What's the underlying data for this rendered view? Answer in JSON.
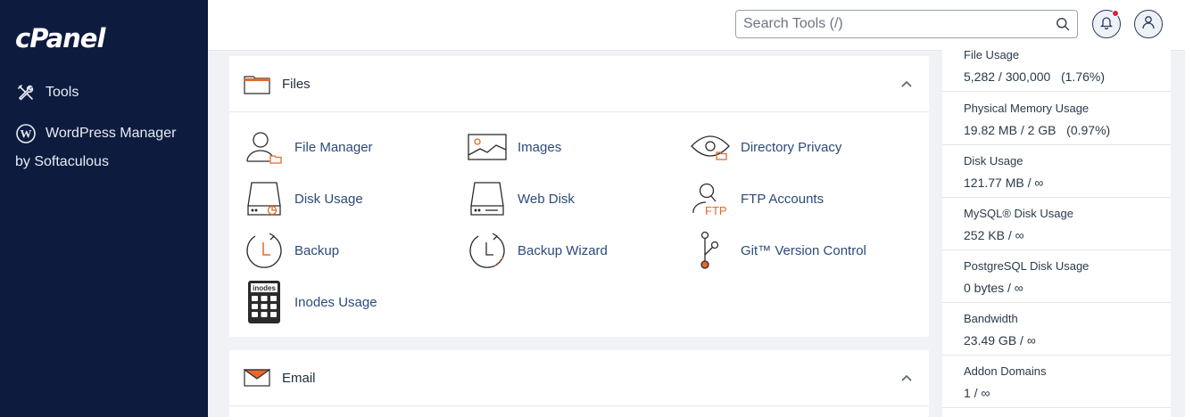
{
  "brand": {
    "logo_text": "cPanel"
  },
  "sidebar": {
    "items": [
      {
        "label": "Tools",
        "icon": "tools-icon"
      },
      {
        "label": "WordPress Manager",
        "sub": "by Softaculous",
        "icon": "wordpress-icon"
      }
    ]
  },
  "topbar": {
    "search_placeholder": "Search Tools (/)",
    "notification_badge_color": "#d6263a"
  },
  "panels": [
    {
      "title": "Files",
      "tools": [
        {
          "label": "File Manager",
          "icon": "file-manager-icon"
        },
        {
          "label": "Images",
          "icon": "images-icon"
        },
        {
          "label": "Directory Privacy",
          "icon": "directory-privacy-icon"
        },
        {
          "label": "Disk Usage",
          "icon": "disk-usage-icon"
        },
        {
          "label": "Web Disk",
          "icon": "web-disk-icon"
        },
        {
          "label": "FTP Accounts",
          "icon": "ftp-accounts-icon"
        },
        {
          "label": "Backup",
          "icon": "backup-icon"
        },
        {
          "label": "Backup Wizard",
          "icon": "backup-wizard-icon"
        },
        {
          "label": "Git™ Version Control",
          "icon": "git-icon"
        },
        {
          "label": "Inodes Usage",
          "icon": "inodes-icon",
          "icon_text": "inodes"
        }
      ]
    },
    {
      "title": "Email"
    }
  ],
  "stats": [
    {
      "label": "File Usage",
      "value": "5,282 / 300,000   (1.76%)"
    },
    {
      "label": "Physical Memory Usage",
      "value": "19.82 MB / 2 GB   (0.97%)"
    },
    {
      "label": "Disk Usage",
      "value": "121.77 MB / ∞"
    },
    {
      "label": "MySQL® Disk Usage",
      "value": "252 KB / ∞"
    },
    {
      "label": "PostgreSQL Disk Usage",
      "value": "0 bytes / ∞"
    },
    {
      "label": "Bandwidth",
      "value": "23.49 GB / ∞"
    },
    {
      "label": "Addon Domains",
      "value": "1 / ∞"
    }
  ],
  "colors": {
    "sidebar_bg": "#0d1b3e",
    "accent_orange": "#e8672b",
    "link_blue": "#2c4a7a"
  }
}
